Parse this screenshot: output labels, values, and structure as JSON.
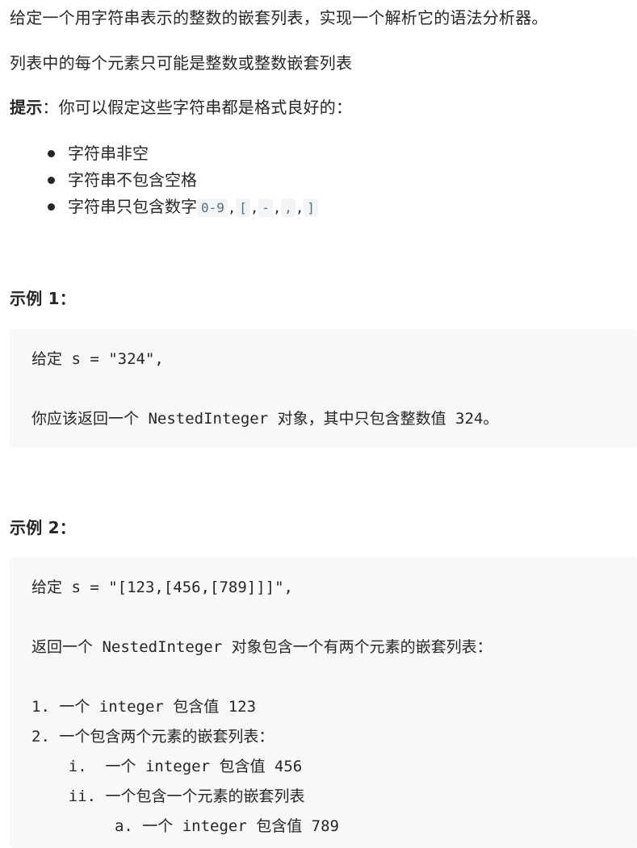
{
  "intro": {
    "line1": "给定一个用字符串表示的整数的嵌套列表，实现一个解析它的语法分析器。",
    "line2": "列表中的每个元素只可能是整数或整数嵌套列表",
    "hint_label": "提示",
    "hint_text": "：你可以假定这些字符串都是格式良好的："
  },
  "bullets": {
    "item1": "字符串非空",
    "item2": "字符串不包含空格",
    "item3_text": "字符串只包含数字",
    "item3_codes": [
      "0-9",
      "[",
      "-",
      ",",
      "]"
    ],
    "comma": ","
  },
  "example1": {
    "heading": "示例 1",
    "colon": "：",
    "lines": [
      "给定 s = \"324\",",
      "你应该返回一个 NestedInteger 对象，其中只包含整数值 324。"
    ]
  },
  "example2": {
    "heading": "示例 2",
    "colon": "：",
    "lines": [
      "给定 s = \"[123,[456,[789]]]\",",
      "返回一个 NestedInteger 对象包含一个有两个元素的嵌套列表：",
      "1. 一个 integer 包含值 123",
      "2. 一个包含两个元素的嵌套列表：",
      "    i.  一个 integer 包含值 456",
      "    ii. 一个包含一个元素的嵌套列表",
      "         a. 一个 integer 包含值 789"
    ]
  }
}
